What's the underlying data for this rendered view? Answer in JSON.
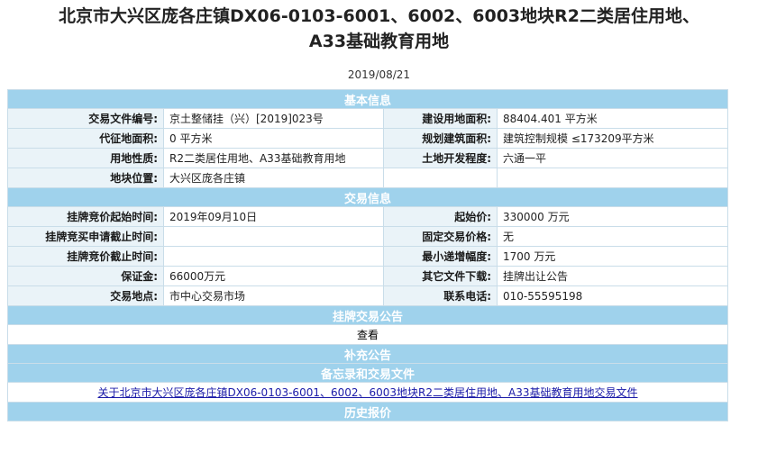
{
  "title_line1": "北京市大兴区庞各庄镇DX06-0103-6001、6002、6003地块R2二类居住用地、",
  "title_line2": "A33基础教育用地",
  "date": "2019/08/21",
  "sections": {
    "basic": "基本信息",
    "trade": "交易信息",
    "notice": "挂牌交易公告",
    "supplement": "补充公告",
    "memo": "备忘录和交易文件",
    "history": "历史报价"
  },
  "basic": {
    "file_no_label": "交易文件编号:",
    "file_no": "京土整储挂（兴）[2019]023号",
    "build_area_label": "建设用地面积:",
    "build_area": "88404.401 平方米",
    "acq_area_label": "代征地面积:",
    "acq_area": "0 平方米",
    "plan_area_label": "规划建筑面积:",
    "plan_area": "建筑控制规模 ≤173209平方米",
    "use_label": "用地性质:",
    "use": "R2二类居住用地、A33基础教育用地",
    "dev_label": "土地开发程度:",
    "dev": "六通一平",
    "location_label": "地块位置:",
    "location": "大兴区庞各庄镇"
  },
  "trade": {
    "start_time_label": "挂牌竞价起始时间:",
    "start_time": "2019年09月10日",
    "start_price_label": "起始价:",
    "start_price": "330000 万元",
    "apply_deadline_label": "挂牌竞买申请截止时间:",
    "apply_deadline": "",
    "fixed_price_label": "固定交易价格:",
    "fixed_price": "无",
    "bid_deadline_label": "挂牌竞价截止时间:",
    "bid_deadline": "",
    "min_increment_label": "最小递增幅度:",
    "min_increment": "1700 万元",
    "deposit_label": "保证金:",
    "deposit": "66000万元",
    "other_docs_label": "其它文件下载:",
    "other_docs": "挂牌出让公告",
    "venue_label": "交易地点:",
    "venue": "市中心交易市场",
    "phone_label": "联系电话:",
    "phone": "010-55595198"
  },
  "notice_view": "查看",
  "memo_link": "关于北京市大兴区庞各庄镇DX06-0103-6001、6002、6003地块R2二类居住用地、A33基础教育用地交易文件"
}
